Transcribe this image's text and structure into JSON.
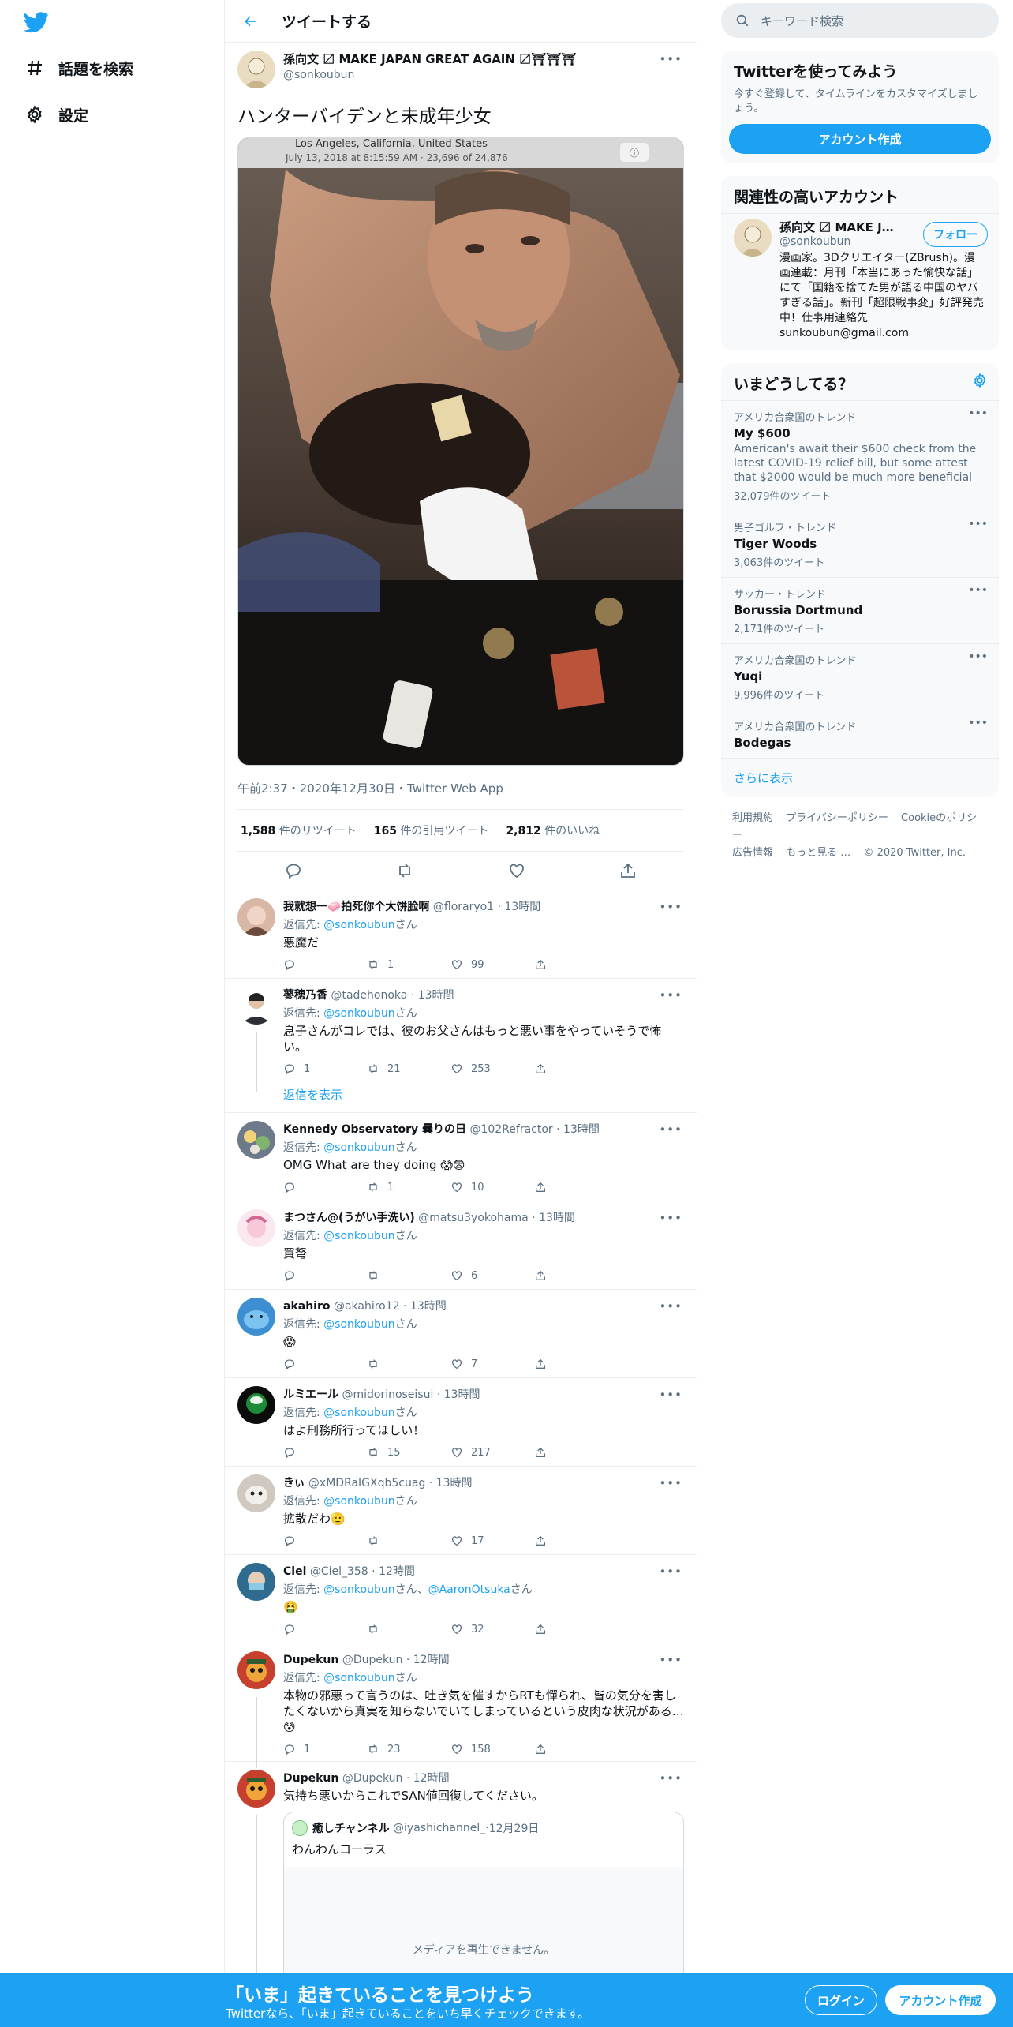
{
  "colors": {
    "accent": "#1da1f2",
    "text": "#0f1419",
    "secondary": "#5b7083",
    "border": "#ebeef0"
  },
  "nav": {
    "logo_icon": "twitter-bird-icon",
    "items": [
      {
        "label": "話題を検索",
        "icon": "hashtag-icon"
      },
      {
        "label": "設定",
        "icon": "gear-icon"
      }
    ]
  },
  "header": {
    "title": "ツイートする"
  },
  "tweet": {
    "author_name": "孫向文 〼 MAKE JAPAN GREAT AGAIN 〼⛩⛩⛩",
    "author_handle": "@sonkoubun",
    "text": "ハンターバイデンと未成年少女",
    "media_overlay_location": "Los Angeles, California, United States",
    "media_overlay_meta": "July 13, 2018 at 8:15:59 AM  ·  23,696 of 24,876",
    "timestamp": "午前2:37・2020年12月30日・Twitter Web App",
    "stats": [
      {
        "num": "1,588",
        "label": " 件のリツイート"
      },
      {
        "num": "165",
        "label": " 件の引用ツイート"
      },
      {
        "num": "2,812",
        "label": " 件のいいね"
      }
    ]
  },
  "replies": [
    {
      "name": "我就想一🧼拍死你个大饼脸啊",
      "handle": "@floraryo1",
      "time": "13時間",
      "reply_to_prefix": "返信先: ",
      "reply_to": "@sonkoubun",
      "reply_to_suffix": "さん",
      "text": "悪魔だ",
      "replies": "",
      "retweets": "1",
      "likes": "99"
    },
    {
      "name": "蓼穂乃香",
      "handle": "@tadehonoka",
      "time": "13時間",
      "reply_to_prefix": "返信先: ",
      "reply_to": "@sonkoubun",
      "reply_to_suffix": "さん",
      "text": "息子さんがコレでは、彼のお父さんはもっと悪い事をやっていそうで怖い。",
      "replies": "1",
      "retweets": "21",
      "likes": "253",
      "show_replies": "返信を表示"
    },
    {
      "name": "Kennedy Observatory 曇りの日",
      "handle": "@102Refractor",
      "time": "13時間",
      "reply_to_prefix": "返信先: ",
      "reply_to": "@sonkoubun",
      "reply_to_suffix": "さん",
      "text": "OMG What are they doing 😱😨",
      "replies": "",
      "retweets": "1",
      "likes": "10"
    },
    {
      "name": "まつさん@(うがい手洗い)",
      "handle": "@matsu3yokohama",
      "time": "13時間",
      "reply_to_prefix": "返信先: ",
      "reply_to": "@sonkoubun",
      "reply_to_suffix": "さん",
      "text": "買弩",
      "replies": "",
      "retweets": "",
      "likes": "6"
    },
    {
      "name": "akahiro",
      "handle": "@akahiro12",
      "time": "13時間",
      "reply_to_prefix": "返信先: ",
      "reply_to": "@sonkoubun",
      "reply_to_suffix": "さん",
      "text": "😱",
      "replies": "",
      "retweets": "",
      "likes": "7"
    },
    {
      "name": "ルミエール",
      "handle": "@midorinoseisui",
      "time": "13時間",
      "reply_to_prefix": "返信先: ",
      "reply_to": "@sonkoubun",
      "reply_to_suffix": "さん",
      "text": "はよ刑務所行ってほしい！",
      "replies": "",
      "retweets": "15",
      "likes": "217"
    },
    {
      "name": "きぃ",
      "handle": "@xMDRaIGXqb5cuag",
      "time": "13時間",
      "reply_to_prefix": "返信先: ",
      "reply_to": "@sonkoubun",
      "reply_to_suffix": "さん",
      "text": "拡散だわ🫡",
      "replies": "",
      "retweets": "",
      "likes": "17"
    },
    {
      "name": "Ciel",
      "handle": "@Ciel_358",
      "time": "12時間",
      "reply_to_prefix": "返信先: ",
      "reply_to": "@sonkoubun",
      "reply_to_suffix": "さん、",
      "reply_to2": "@AaronOtsuka",
      "reply_to2_suffix": "さん",
      "text": "🤮",
      "replies": "",
      "retweets": "",
      "likes": "32"
    },
    {
      "name": "Dupekun",
      "handle": "@Dupekun",
      "time": "12時間",
      "reply_to_prefix": "返信先: ",
      "reply_to": "@sonkoubun",
      "reply_to_suffix": "さん",
      "text": "本物の邪悪って言うのは、吐き気を催すからRTも憚られ、皆の気分を害したくないから真実を知らないでいてしまっているという皮肉な状況がある…😰",
      "replies": "1",
      "retweets": "23",
      "likes": "158"
    }
  ],
  "last_reply": {
    "name": "Dupekun",
    "handle": "@Dupekun",
    "time": "12時間",
    "text": "気持ち悪いからこれでSAN値回復してください。",
    "quote_name": "癒しチャンネル",
    "quote_handle": "@iyashichannel_",
    "quote_time": "12月29日",
    "quote_text": "わんわんコーラス",
    "quote_media_msg": "メディアを再生できません。"
  },
  "sidebar": {
    "search_placeholder": "キーワード検索",
    "signup_title": "Twitterを使ってみよう",
    "signup_sub": "今すぐ登録して、タイムラインをカスタマイズしましょう。",
    "signup_button": "アカウント作成",
    "related_title": "関連性の高いアカウント",
    "related_name": "孫向文 〼 MAKE JAPAN GREAT AGAIN",
    "related_handle": "@sonkoubun",
    "follow_button": "フォロー",
    "related_bio": "漫画家。3Dクリエイター(ZBrush)。漫画連載：月刊「本当にあった愉快な話」にて「国籍を捨てた男が語る中国のヤバすぎる話」。新刊「超限戦事変」好評発売中！仕事用連絡先 sunkoubun@gmail.com",
    "trends_title": "いまどうしてる？",
    "trends": [
      {
        "context": "アメリカ合衆国のトレンド",
        "name": "My $600",
        "desc": "American's await their $600 check from the latest COVID-19 relief bill, but some attest that $2000 would be much more beneficial",
        "count": "32,079件のツイート"
      },
      {
        "context": "男子ゴルフ・トレンド",
        "name": "Tiger Woods",
        "desc": "",
        "count": "3,063件のツイート"
      },
      {
        "context": "サッカー・トレンド",
        "name": "Borussia Dortmund",
        "desc": "",
        "count": "2,171件のツイート"
      },
      {
        "context": "アメリカ合衆国のトレンド",
        "name": "Yuqi",
        "desc": "",
        "count": "9,996件のツイート"
      },
      {
        "context": "アメリカ合衆国のトレンド",
        "name": "Bodegas",
        "desc": "",
        "count": ""
      }
    ],
    "show_more": "さらに表示",
    "footer_line1": [
      "利用規約",
      "プライバシーポリシー",
      "Cookieのポリシー"
    ],
    "footer_line2": [
      "広告情報",
      "もっと見る …",
      "© 2020 Twitter, Inc."
    ]
  },
  "bottom_bar": {
    "title": "「いま」起きていることを見つけよう",
    "subtitle": "Twitterなら、「いま」起きていることをいち早くチェックできます。",
    "login": "ログイン",
    "signup": "アカウント作成"
  }
}
